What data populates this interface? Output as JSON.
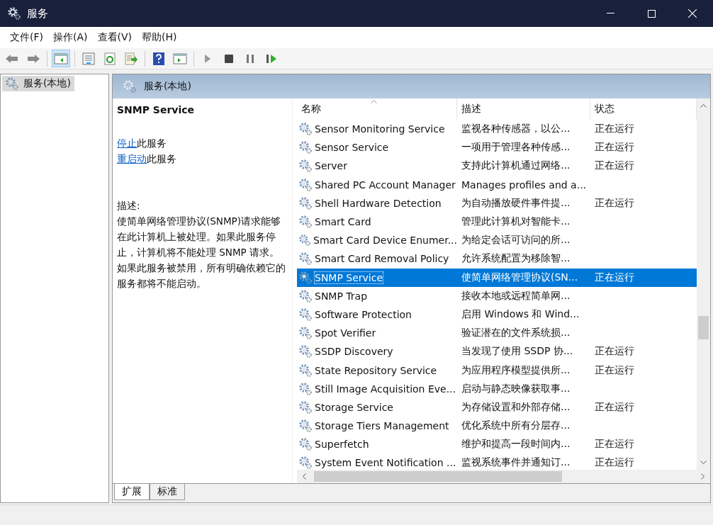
{
  "window": {
    "title": "服务"
  },
  "menu": [
    "文件(F)",
    "操作(A)",
    "查看(V)",
    "帮助(H)"
  ],
  "toolbar_groups": [
    {
      "buttons": [
        {
          "kind": "back",
          "pressed": false
        },
        {
          "kind": "forward",
          "pressed": false
        }
      ]
    },
    {
      "buttons": [
        {
          "kind": "tree",
          "pressed": true
        }
      ]
    },
    {
      "buttons": [
        {
          "kind": "properties",
          "pressed": false
        },
        {
          "kind": "refresh",
          "pressed": false
        },
        {
          "kind": "export",
          "pressed": false
        }
      ]
    },
    {
      "buttons": [
        {
          "kind": "help",
          "pressed": false
        },
        {
          "kind": "action-pane",
          "pressed": false
        }
      ]
    },
    {
      "buttons": [
        {
          "kind": "start",
          "pressed": false
        },
        {
          "kind": "stop",
          "pressed": false
        },
        {
          "kind": "pause",
          "pressed": false
        },
        {
          "kind": "restart",
          "pressed": false
        }
      ]
    }
  ],
  "tree": {
    "items": [
      {
        "label": "服务(本地)",
        "selected": true
      }
    ]
  },
  "panel": {
    "title": "服务(本地)"
  },
  "details": {
    "service_name": "SNMP Service",
    "actions": [
      {
        "link": "停止",
        "text": "此服务"
      },
      {
        "link": "重启动",
        "text": "此服务"
      }
    ],
    "description_label": "描述:",
    "description": "使简单网络管理协议(SNMP)请求能够在此计算机上被处理。如果此服务停止，计算机将不能处理 SNMP 请求。如果此服务被禁用，所有明确依赖它的服务都将不能启动。"
  },
  "table": {
    "columns": [
      {
        "label": "名称",
        "sorted": true
      },
      {
        "label": "描述",
        "sorted": false
      },
      {
        "label": "状态",
        "sorted": false
      }
    ],
    "rows": [
      {
        "name": "Sensor Monitoring Service",
        "description": "监视各种传感器，以公...",
        "status": "正在运行",
        "selected": false
      },
      {
        "name": "Sensor Service",
        "description": "一项用于管理各种传感...",
        "status": "正在运行",
        "selected": false
      },
      {
        "name": "Server",
        "description": "支持此计算机通过网络...",
        "status": "正在运行",
        "selected": false
      },
      {
        "name": "Shared PC Account Manager",
        "description": "Manages profiles and a...",
        "selected": false
      },
      {
        "name": "Shell Hardware Detection",
        "description": "为自动播放硬件事件提...",
        "status": "正在运行",
        "selected": false
      },
      {
        "name": "Smart Card",
        "description": "管理此计算机对智能卡...",
        "selected": false
      },
      {
        "name": "Smart Card Device Enumer...",
        "description": "为给定会话可访问的所...",
        "selected": false
      },
      {
        "name": "Smart Card Removal Policy",
        "description": "允许系统配置为移除智...",
        "selected": false
      },
      {
        "name": "SNMP Service",
        "description": "使简单网络管理协议(SN...",
        "status": "正在运行",
        "selected": true
      },
      {
        "name": "SNMP Trap",
        "description": "接收本地或远程简单网...",
        "selected": false
      },
      {
        "name": "Software Protection",
        "description": "启用 Windows 和 Wind...",
        "selected": false
      },
      {
        "name": "Spot Verifier",
        "description": "验证潜在的文件系统损...",
        "selected": false
      },
      {
        "name": "SSDP Discovery",
        "description": "当发现了使用 SSDP 协...",
        "status": "正在运行",
        "selected": false
      },
      {
        "name": "State Repository Service",
        "description": "为应用程序模型提供所...",
        "status": "正在运行",
        "selected": false
      },
      {
        "name": "Still Image Acquisition Eve...",
        "description": "启动与静态映像获取事...",
        "selected": false
      },
      {
        "name": "Storage Service",
        "description": "为存储设置和外部存储...",
        "status": "正在运行",
        "selected": false
      },
      {
        "name": "Storage Tiers Management",
        "description": "优化系统中所有分层存...",
        "selected": false
      },
      {
        "name": "Superfetch",
        "description": "维护和提高一段时间内...",
        "status": "正在运行",
        "selected": false
      },
      {
        "name": "System Event Notification ...",
        "description": "监视系统事件并通知订...",
        "status": "正在运行",
        "selected": false
      }
    ]
  },
  "view_tabs": [
    {
      "label": "扩展",
      "selected": true
    },
    {
      "label": "标准",
      "selected": false
    }
  ]
}
